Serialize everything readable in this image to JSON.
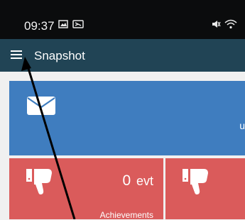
{
  "status_bar": {
    "time": "09:37",
    "icons": [
      "gallery-icon",
      "notification-icon",
      "mute-icon",
      "wifi-icon"
    ]
  },
  "app_bar": {
    "menu_icon": "hamburger-menu-icon",
    "title": "Snapshot"
  },
  "cards": {
    "messages": {
      "icon": "envelope-icon",
      "truncated_text": "u"
    },
    "achievements": {
      "icon": "thumbs-down-icon",
      "count": "0",
      "unit": "evt",
      "label": "Achievements"
    },
    "second": {
      "icon": "thumbs-down-icon"
    }
  },
  "colors": {
    "status_bar": "#0b0c0d",
    "app_bar": "#214455",
    "blue_card": "#3f7dbf",
    "red_card": "#da5b5b",
    "background": "#f0f0f0"
  }
}
